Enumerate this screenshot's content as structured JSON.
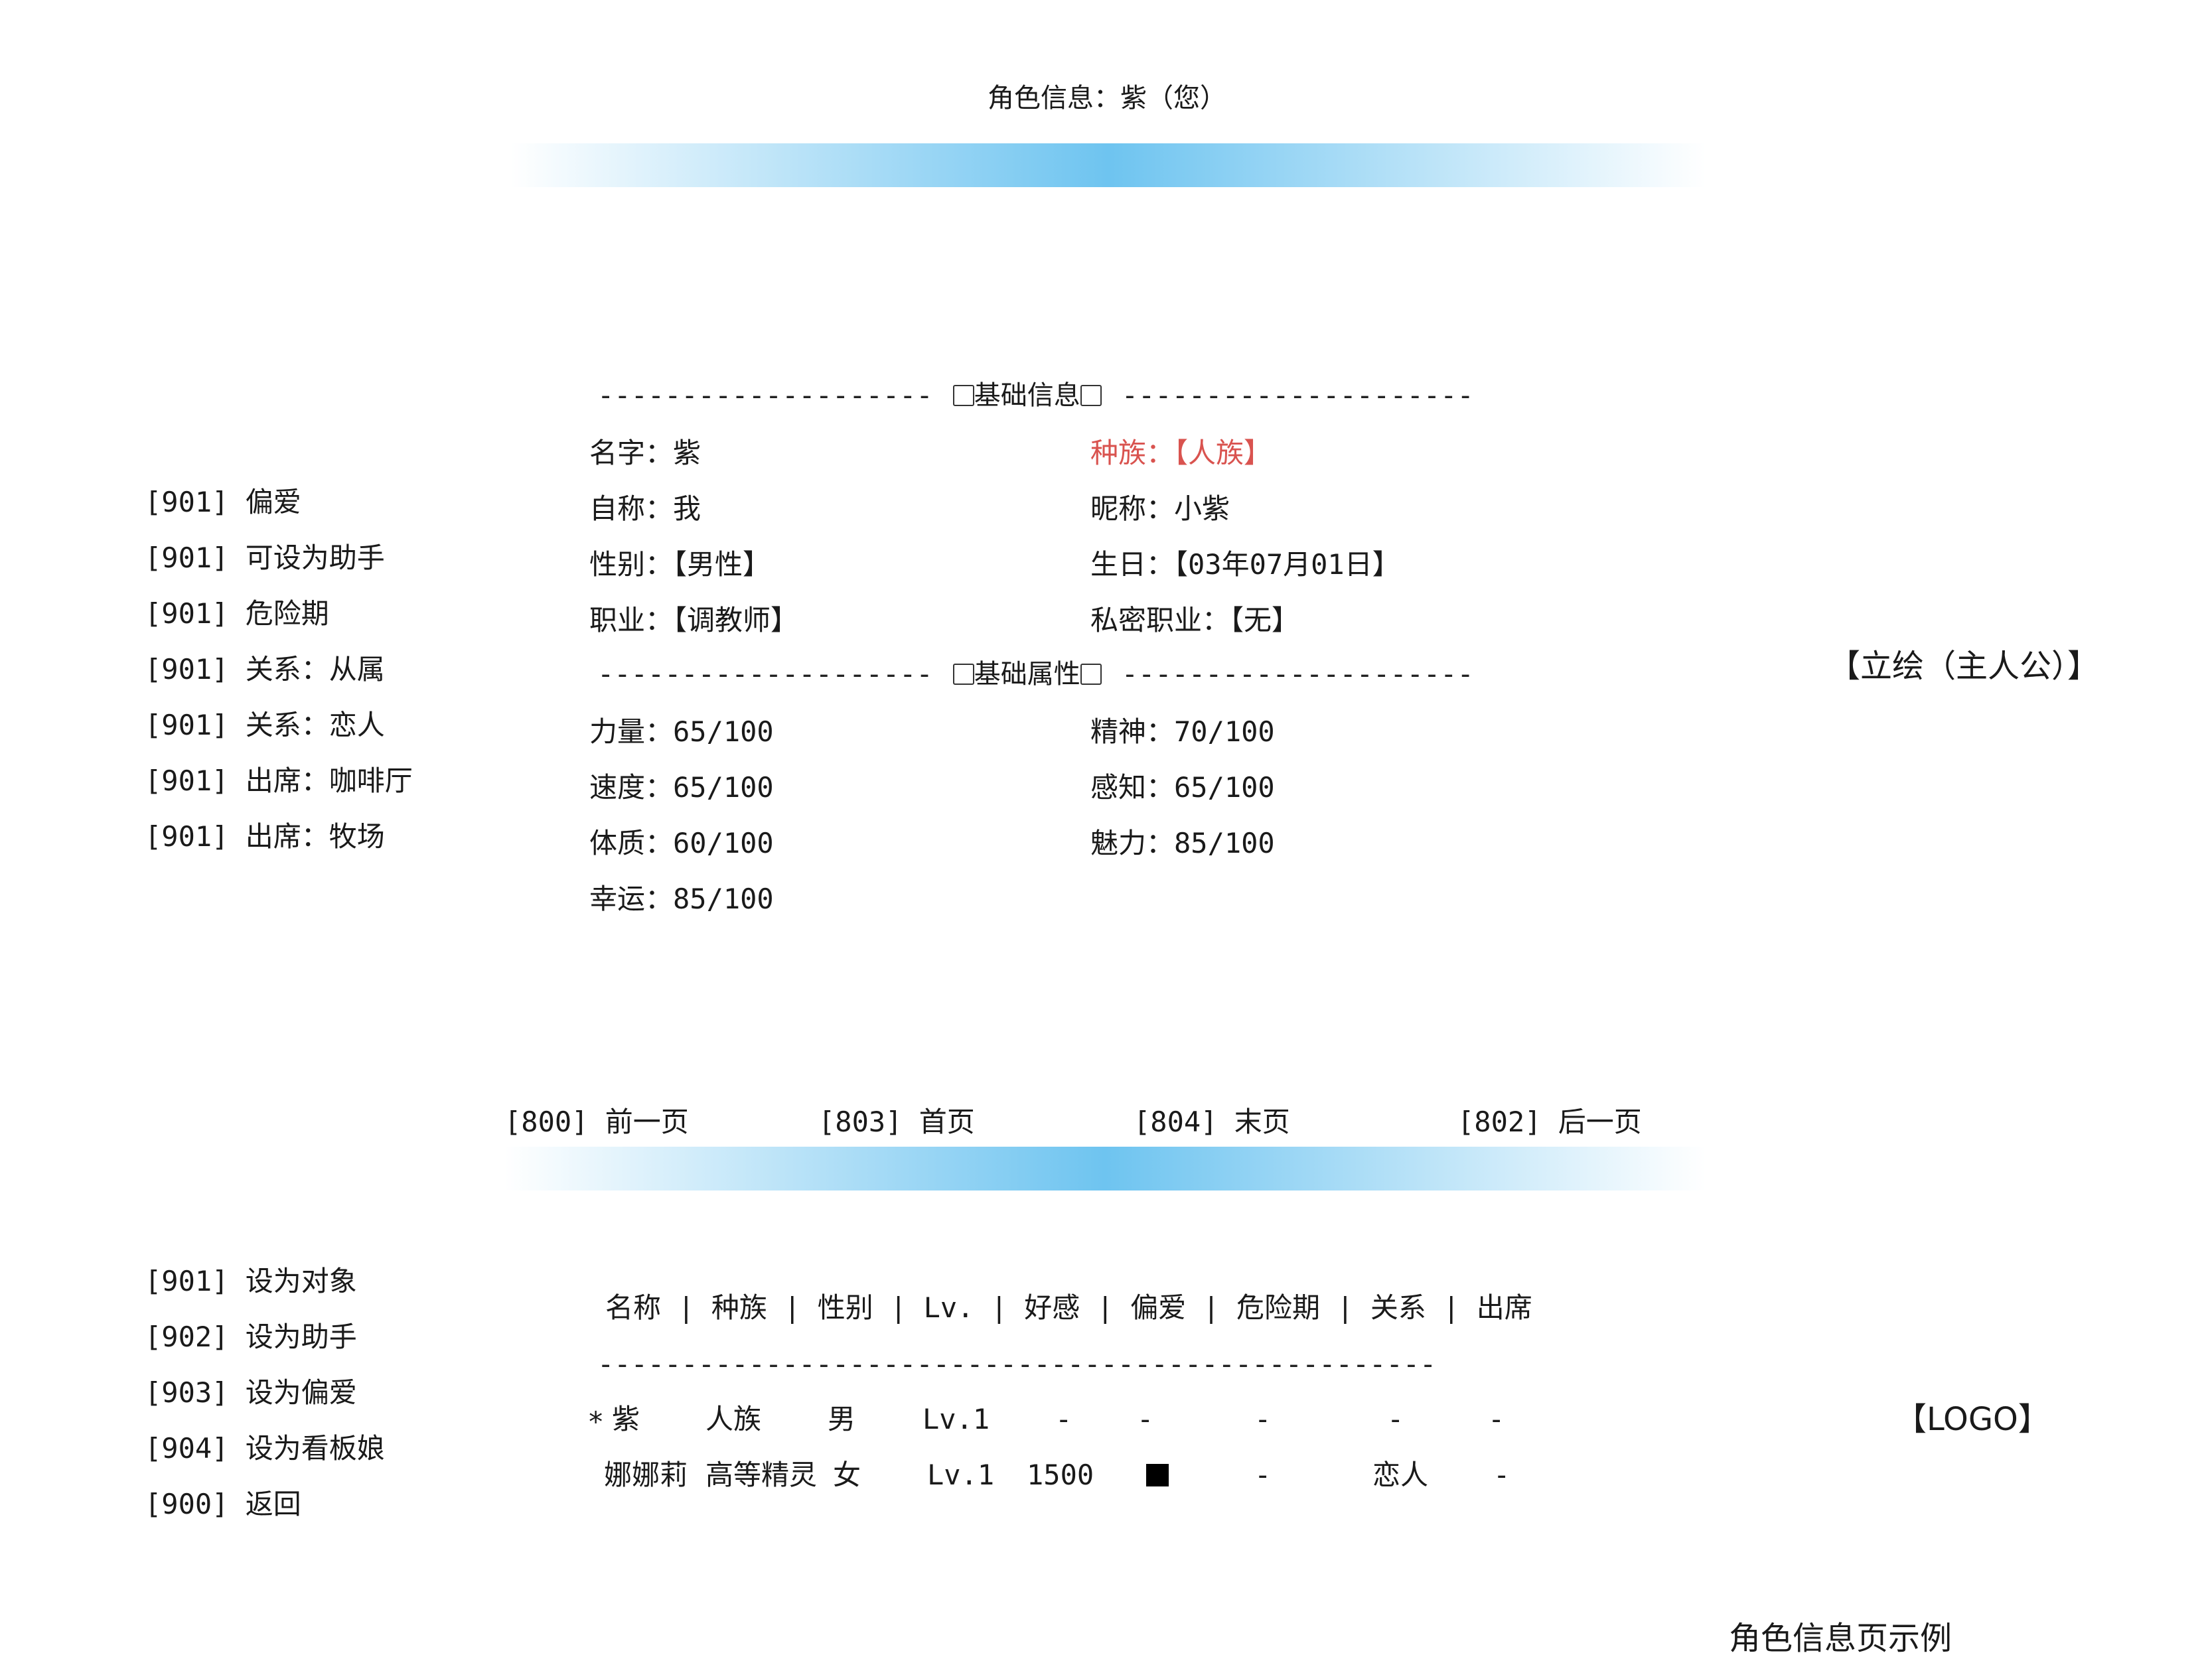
{
  "header": {
    "title": "角色信息：紫（您）"
  },
  "basic_section": {
    "label": "基础信息",
    "dashes_left": "--------------------",
    "dashes_right": "---------------------"
  },
  "basic_info": {
    "name": "名字：紫",
    "race": "种族：【人族】",
    "self_call": "自称：我",
    "nickname": "昵称：小紫",
    "gender": "性别：【男性】",
    "birthday": "生日：【03年07月01日】",
    "job": "职业：【调教师】",
    "secret_job": "私密职业：【无】"
  },
  "attr_section": {
    "label": "基础属性",
    "dashes_left": "--------------------",
    "dashes_right": "---------------------"
  },
  "attributes": {
    "strength": "力量：65/100",
    "spirit": "精神：70/100",
    "speed": "速度：65/100",
    "perception": "感知：65/100",
    "constitution": "体质：60/100",
    "charm": "魅力：85/100",
    "luck": "幸运：85/100"
  },
  "top_commands": [
    "[901] 偏爱",
    "[901] 可设为助手",
    "[901] 危险期",
    "[901] 关系：从属",
    "[901] 关系：恋人",
    "[901] 出席：咖啡厅",
    "[901] 出席：牧场"
  ],
  "portrait_label": "【立绘（主人公）】",
  "pagination": {
    "prev": "[800] 前一页",
    "first": "[803] 首页",
    "last": "[804] 末页",
    "next": "[802] 后一页"
  },
  "bottom_commands": [
    "[901] 设为对象",
    "[902] 设为助手",
    "[903] 设为偏爱",
    "[904] 设为看板娘",
    "[900] 返回"
  ],
  "table": {
    "header": "名称 | 种族 | 性别 | Lv. | 好感 | 偏爱 | 危险期 | 关系 | 出席",
    "divider": "--------------------------------------------------",
    "rows": [
      {
        "marker": "*",
        "name": "紫",
        "race": "人族",
        "gender": "男",
        "lv": "Lv.1",
        "favor": "-",
        "pref": "-",
        "danger": "-",
        "relation": "-",
        "attend": "-"
      },
      {
        "marker": "",
        "name": "娜娜莉",
        "race": "高等精灵",
        "gender": "女",
        "lv": "Lv.1",
        "favor": "1500",
        "pref": "■",
        "danger": "-",
        "relation": "恋人",
        "attend": "-"
      }
    ]
  },
  "logo_label": "【LOGO】",
  "footer_caption": "角色信息页示例"
}
